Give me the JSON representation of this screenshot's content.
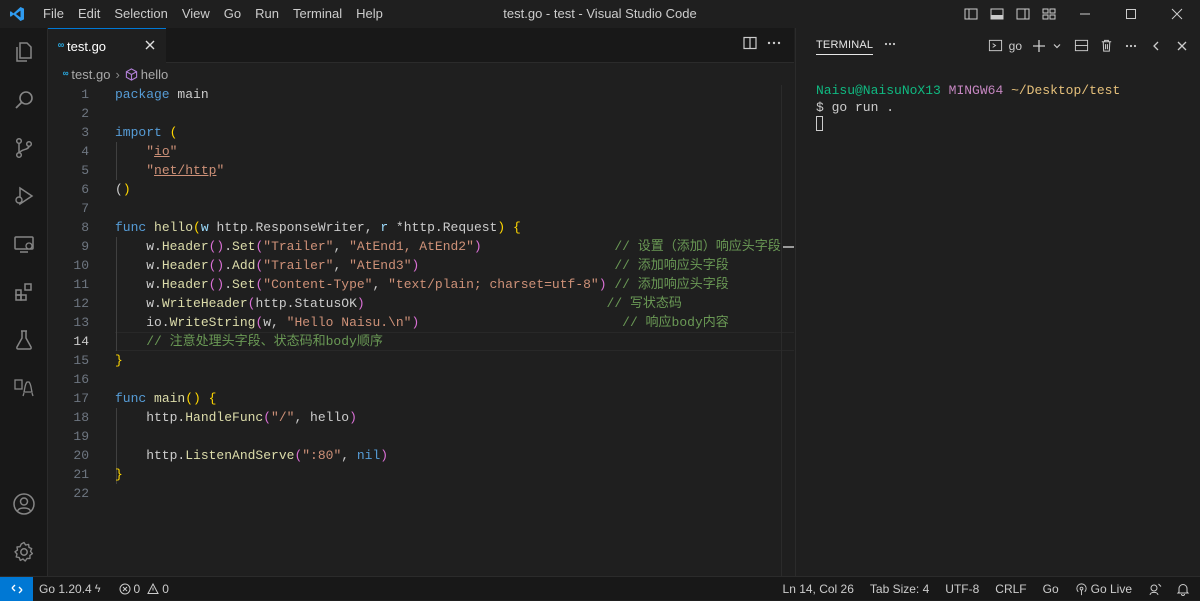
{
  "titlebar": {
    "menu": [
      "File",
      "Edit",
      "Selection",
      "View",
      "Go",
      "Run",
      "Terminal",
      "Help"
    ],
    "title": "test.go - test - Visual Studio Code"
  },
  "editor": {
    "tab_icon": "∞",
    "tab_label": "test.go",
    "breadcrumb": {
      "file": "test.go",
      "symbol": "hello"
    },
    "current_line": 14,
    "lines": [
      [
        [
          "package",
          "kw"
        ],
        [
          " main",
          ""
        ]
      ],
      [],
      [
        [
          "import",
          "kw"
        ],
        [
          " ",
          ""
        ],
        [
          "(",
          "pr"
        ]
      ],
      [
        [
          "    ",
          ""
        ],
        [
          "\"",
          "st"
        ],
        [
          "io",
          "st udl"
        ],
        [
          "\"",
          "st"
        ]
      ],
      [
        [
          "    ",
          ""
        ],
        [
          "\"",
          "st"
        ],
        [
          "net/http",
          "st udl"
        ],
        [
          "\"",
          "st"
        ]
      ],
      [
        [
          "(",
          ""
        ],
        [
          ")",
          "pr"
        ]
      ],
      [],
      [
        [
          "func",
          "kw"
        ],
        [
          " ",
          ""
        ],
        [
          "hello",
          "fn"
        ],
        [
          "(",
          "pr"
        ],
        [
          "w",
          "vb"
        ],
        [
          " http.ResponseWriter, ",
          ""
        ],
        [
          "r",
          "vb"
        ],
        [
          " *http.Request",
          ""
        ],
        [
          ")",
          "pr"
        ],
        [
          " ",
          ""
        ],
        [
          "{",
          "pr"
        ]
      ],
      [
        [
          "    w.",
          ""
        ],
        [
          "Header",
          "fn"
        ],
        [
          "()",
          "pr2"
        ],
        [
          ".",
          ""
        ],
        [
          "Set",
          "fn"
        ],
        [
          "(",
          "pr2"
        ],
        [
          "\"Trailer\"",
          "st"
        ],
        [
          ", ",
          ""
        ],
        [
          "\"AtEnd1, AtEnd2\"",
          "st"
        ],
        [
          ")",
          "pr2"
        ],
        [
          "                 ",
          ""
        ],
        [
          "// 设置（添加）响应头字段",
          "cm"
        ]
      ],
      [
        [
          "    w.",
          ""
        ],
        [
          "Header",
          "fn"
        ],
        [
          "()",
          "pr2"
        ],
        [
          ".",
          ""
        ],
        [
          "Add",
          "fn"
        ],
        [
          "(",
          "pr2"
        ],
        [
          "\"Trailer\"",
          "st"
        ],
        [
          ", ",
          ""
        ],
        [
          "\"AtEnd3\"",
          "st"
        ],
        [
          ")",
          "pr2"
        ],
        [
          "                         ",
          ""
        ],
        [
          "// 添加响应头字段",
          "cm"
        ]
      ],
      [
        [
          "    w.",
          ""
        ],
        [
          "Header",
          "fn"
        ],
        [
          "()",
          "pr2"
        ],
        [
          ".",
          ""
        ],
        [
          "Set",
          "fn"
        ],
        [
          "(",
          "pr2"
        ],
        [
          "\"Content-Type\"",
          "st"
        ],
        [
          ", ",
          ""
        ],
        [
          "\"text/plain; charset=utf-8\"",
          "st"
        ],
        [
          ")",
          "pr2"
        ],
        [
          " ",
          ""
        ],
        [
          "// 添加响应头字段",
          "cm"
        ]
      ],
      [
        [
          "    w.",
          ""
        ],
        [
          "WriteHeader",
          "fn"
        ],
        [
          "(",
          "pr2"
        ],
        [
          "http.StatusOK",
          ""
        ],
        [
          ")",
          "pr2"
        ],
        [
          "                               ",
          ""
        ],
        [
          "// 写状态码",
          "cm"
        ]
      ],
      [
        [
          "    io.",
          ""
        ],
        [
          "WriteString",
          "fn"
        ],
        [
          "(",
          "pr2"
        ],
        [
          "w, ",
          ""
        ],
        [
          "\"Hello Naisu.\\n\"",
          "st"
        ],
        [
          ")",
          "pr2"
        ],
        [
          "                          ",
          ""
        ],
        [
          "// 响应body内容",
          "cm"
        ]
      ],
      [
        [
          "    ",
          ""
        ],
        [
          "// 注意处理头字段、状态码和body顺序",
          "cm"
        ]
      ],
      [
        [
          "}",
          "pr"
        ]
      ],
      [],
      [
        [
          "func",
          "kw"
        ],
        [
          " ",
          ""
        ],
        [
          "main",
          "fn"
        ],
        [
          "()",
          "pr"
        ],
        [
          " ",
          ""
        ],
        [
          "{",
          "pr"
        ]
      ],
      [
        [
          "    http.",
          ""
        ],
        [
          "HandleFunc",
          "fn"
        ],
        [
          "(",
          "pr2"
        ],
        [
          "\"/\"",
          "st"
        ],
        [
          ", hello",
          ""
        ],
        [
          ")",
          "pr2"
        ]
      ],
      [],
      [
        [
          "    http.",
          ""
        ],
        [
          "ListenAndServe",
          "fn"
        ],
        [
          "(",
          "pr2"
        ],
        [
          "\":80\"",
          "st"
        ],
        [
          ", ",
          ""
        ],
        [
          "nil",
          "kw"
        ],
        [
          ")",
          "pr2"
        ]
      ],
      [
        [
          "}",
          "pr"
        ]
      ],
      []
    ]
  },
  "panel": {
    "title": "TERMINAL",
    "profile": "go",
    "prompt_user": "Naisu@NaisuNoX13",
    "prompt_env": "MINGW64",
    "prompt_path": "~/Desktop/test",
    "command": "$ go run ."
  },
  "status": {
    "go_version": "Go 1.20.4",
    "errors": "0",
    "warnings": "0",
    "position": "Ln 14, Col 26",
    "tab_size": "Tab Size: 4",
    "encoding": "UTF-8",
    "eol": "CRLF",
    "language": "Go",
    "go_live": "Go Live"
  }
}
